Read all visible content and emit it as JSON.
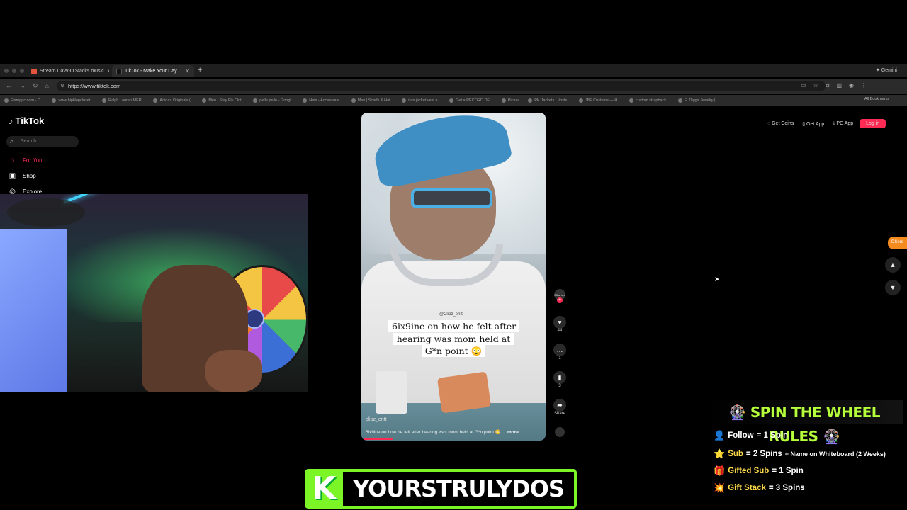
{
  "browser": {
    "tabs": [
      {
        "title": "Stream Davv-O $tacks music",
        "favicon_color": "#e5533d"
      },
      {
        "title": "TikTok - Make Your Day",
        "favicon_color": "#111111"
      }
    ],
    "new_tab": "+",
    "gemini": "✦ Gemini",
    "url": "https://www.tiktok.com",
    "bookmarks": [
      "Flamppc.com - D...",
      "www.hipHopcloset...",
      "Ralph Lauren MER...",
      "Adidas Originals (...",
      "Men | Stay Fly Clot...",
      "pelle pelle - Googl...",
      "Hats - Accessorie...",
      "Men | Scarfs & Hat...",
      "iran jacket vest a...",
      "Get a RECORD DE...",
      "Picasa",
      "Pk. Jackets | Vosts...",
      "JBF Customs — H...",
      "custom strapback...",
      "E. Diggs Jewelry |..."
    ],
    "all_bookmarks": "All Bookmarks"
  },
  "tiktok": {
    "logo": "TikTok",
    "search_placeholder": "Search",
    "nav": [
      {
        "label": "For You",
        "icon": "home-icon"
      },
      {
        "label": "Shop",
        "icon": "shop-icon"
      },
      {
        "label": "Explore",
        "icon": "compass-icon"
      }
    ],
    "top_buttons": {
      "get_coins": "Get Coins",
      "get_app": "Get App",
      "pc_app": "PC App",
      "login": "Log in"
    },
    "video": {
      "watermark": "@Clipz_entt",
      "caption": "6ix9ine on how he felt after hearing was mom held at G*n point 😳",
      "username": "clipz_entt",
      "description": "6ix9ine on how he felt after hearing was mom held at G*n point 😳 ...",
      "more": "more"
    },
    "actions": {
      "avatar_label": "Clipz ent",
      "likes": "44",
      "comments": "1",
      "bookmarks": "3",
      "share": "Share"
    },
    "dsers_tab": "DSers"
  },
  "stream_overlay": {
    "rules_title": "SPIN THE WHEEL RULES",
    "rules": [
      {
        "icon": "👤",
        "key": "Follow",
        "value": "= 1 Spin",
        "extra": ""
      },
      {
        "icon": "⭐",
        "key": "Sub",
        "value": "= 2 Spins",
        "extra": "+ Name on Whiteboard (2 Weeks)"
      },
      {
        "icon": "🎁",
        "key": "Gifted Sub",
        "value": "= 1 Spin",
        "extra": ""
      },
      {
        "icon": "💥",
        "key": "Gift Stack",
        "value": "= 3 Spins",
        "extra": ""
      }
    ],
    "banner_logo": "K",
    "channel_name": "YOURSTRULYDOS",
    "accent": "#7cf526"
  }
}
